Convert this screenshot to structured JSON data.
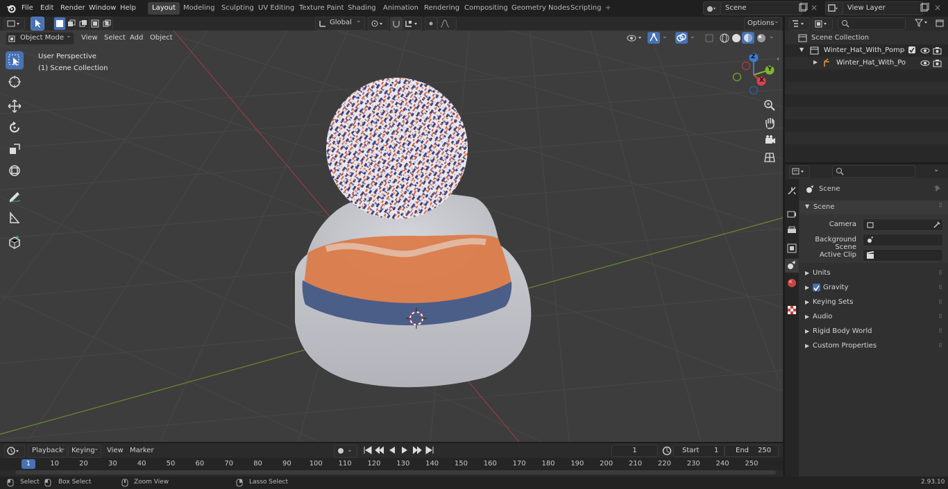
{
  "menu": {
    "file": "File",
    "edit": "Edit",
    "render": "Render",
    "window": "Window",
    "help": "Help"
  },
  "workspaces": [
    "Layout",
    "Modeling",
    "Sculpting",
    "UV Editing",
    "Texture Paint",
    "Shading",
    "Animation",
    "Rendering",
    "Compositing",
    "Geometry Nodes",
    "Scripting"
  ],
  "scene_field": "Scene",
  "view_layer_field": "View Layer",
  "viewport_header": {
    "mode": "Object Mode",
    "view": "View",
    "select": "Select",
    "add": "Add",
    "object": "Object",
    "transform_orientation": "Global",
    "options": "Options"
  },
  "viewport_overlay": {
    "perspective": "User Perspective",
    "collection": "(1) Scene Collection"
  },
  "gizmo": {
    "z": "Z",
    "y": "Y",
    "x": "X"
  },
  "outliner": {
    "root": "Scene Collection",
    "items": [
      "Winter_Hat_With_Pompom_W",
      "Winter_Hat_With_Pompo"
    ]
  },
  "properties": {
    "header": "Scene",
    "panel_title": "Scene",
    "camera_label": "Camera",
    "background_label": "Background Scene",
    "clip_label": "Active Clip",
    "sections": [
      "Units",
      "Gravity",
      "Keying Sets",
      "Audio",
      "Rigid Body World",
      "Custom Properties"
    ]
  },
  "timeline": {
    "playback": "Playback",
    "keying": "Keying",
    "view": "View",
    "marker": "Marker",
    "current_frame": "1",
    "start_label": "Start",
    "start_value": "1",
    "end_label": "End",
    "end_value": "250",
    "ticks": [
      "1",
      "10",
      "20",
      "30",
      "40",
      "50",
      "60",
      "70",
      "80",
      "90",
      "100",
      "110",
      "120",
      "130",
      "140",
      "150",
      "160",
      "170",
      "180",
      "190",
      "200",
      "210",
      "220",
      "230",
      "240",
      "250"
    ]
  },
  "status": {
    "select": "Select",
    "box_select": "Box Select",
    "zoom_view": "Zoom View",
    "lasso_select": "Lasso Select",
    "version": "2.93.10"
  },
  "colors": {
    "accent": "#4772b3",
    "orange": "#e07a3a",
    "navy": "#3b3f7a",
    "hat_white": "#c7c8cf"
  }
}
